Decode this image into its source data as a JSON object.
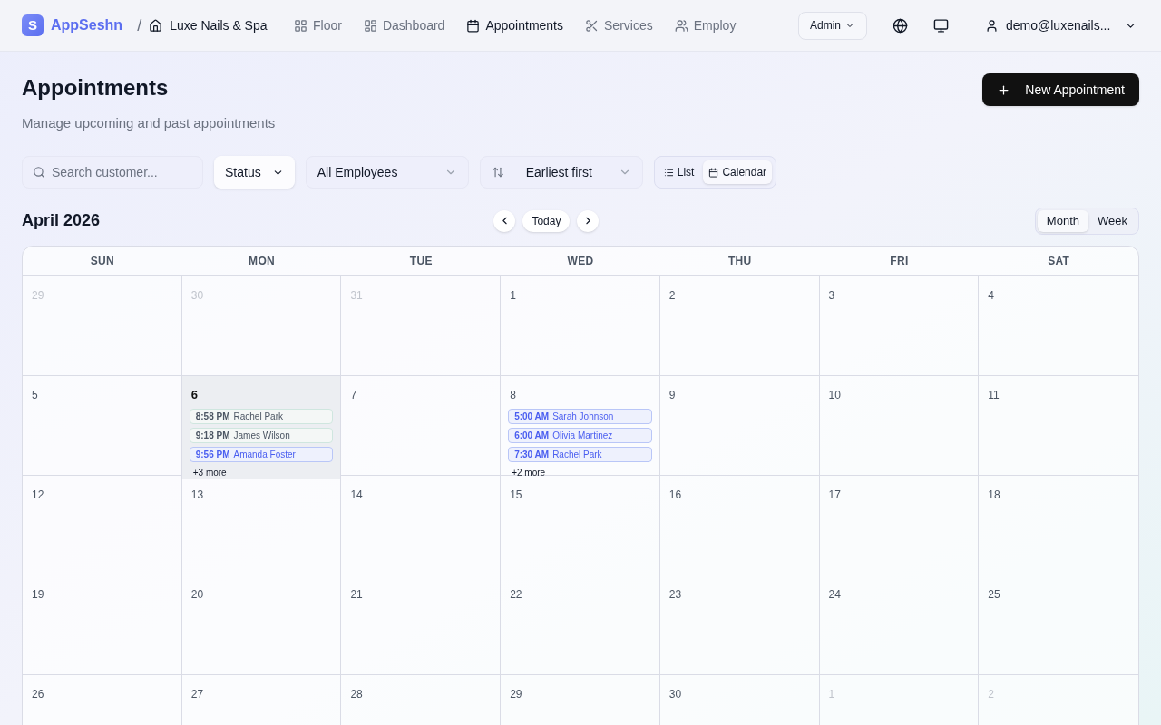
{
  "brand": {
    "logo_letter": "S",
    "name": "AppSeshn",
    "separator": "/",
    "business": "Luxe Nails & Spa"
  },
  "nav": [
    {
      "label": "Floor",
      "selected": false
    },
    {
      "label": "Dashboard",
      "selected": false
    },
    {
      "label": "Appointments",
      "selected": true
    },
    {
      "label": "Services",
      "selected": false
    },
    {
      "label": "Employ",
      "selected": false
    }
  ],
  "role_menu": "Admin",
  "user_menu": "demo@luxenails...",
  "page": {
    "title": "Appointments",
    "subtitle": "Manage upcoming and past appointments",
    "new_button": "New Appointment"
  },
  "filters": {
    "search_placeholder": "Search customer...",
    "status": "Status",
    "employees": "All Employees",
    "sort": "Earliest first",
    "views": [
      {
        "label": "List",
        "selected": false
      },
      {
        "label": "Calendar",
        "selected": true
      }
    ]
  },
  "calendar": {
    "month_label": "April 2026",
    "today_button": "Today",
    "ranges": [
      {
        "label": "Month",
        "selected": true
      },
      {
        "label": "Week",
        "selected": false
      }
    ],
    "weekdays": [
      "SUN",
      "MON",
      "TUE",
      "WED",
      "THU",
      "FRI",
      "SAT"
    ],
    "weeks": [
      [
        {
          "day": "29",
          "in_month": false,
          "selected": false
        },
        {
          "day": "30",
          "in_month": false,
          "selected": false
        },
        {
          "day": "31",
          "in_month": false,
          "selected": false
        },
        {
          "day": "1",
          "in_month": true,
          "selected": false
        },
        {
          "day": "2",
          "in_month": true,
          "selected": false
        },
        {
          "day": "3",
          "in_month": true,
          "selected": false
        },
        {
          "day": "4",
          "in_month": true,
          "selected": false
        }
      ],
      [
        {
          "day": "5",
          "in_month": true,
          "selected": false
        },
        {
          "day": "6",
          "in_month": true,
          "selected": true,
          "events": [
            {
              "time": "8:58 PM",
              "name": "Rachel Park",
              "kind": "completed"
            },
            {
              "time": "9:18 PM",
              "name": "James Wilson",
              "kind": "completed"
            },
            {
              "time": "9:56 PM",
              "name": "Amanda Foster",
              "kind": "scheduled"
            }
          ],
          "more": "+3 more"
        },
        {
          "day": "7",
          "in_month": true,
          "selected": false
        },
        {
          "day": "8",
          "in_month": true,
          "selected": false,
          "events": [
            {
              "time": "5:00 AM",
              "name": "Sarah Johnson",
              "kind": "scheduled"
            },
            {
              "time": "6:00 AM",
              "name": "Olivia Martinez",
              "kind": "scheduled"
            },
            {
              "time": "7:30 AM",
              "name": "Rachel Park",
              "kind": "scheduled"
            }
          ],
          "more": "+2 more"
        },
        {
          "day": "9",
          "in_month": true,
          "selected": false
        },
        {
          "day": "10",
          "in_month": true,
          "selected": false
        },
        {
          "day": "11",
          "in_month": true,
          "selected": false
        }
      ],
      [
        {
          "day": "12",
          "in_month": true,
          "selected": false
        },
        {
          "day": "13",
          "in_month": true,
          "selected": false
        },
        {
          "day": "14",
          "in_month": true,
          "selected": false
        },
        {
          "day": "15",
          "in_month": true,
          "selected": false
        },
        {
          "day": "16",
          "in_month": true,
          "selected": false
        },
        {
          "day": "17",
          "in_month": true,
          "selected": false
        },
        {
          "day": "18",
          "in_month": true,
          "selected": false
        }
      ],
      [
        {
          "day": "19",
          "in_month": true,
          "selected": false
        },
        {
          "day": "20",
          "in_month": true,
          "selected": false
        },
        {
          "day": "21",
          "in_month": true,
          "selected": false
        },
        {
          "day": "22",
          "in_month": true,
          "selected": false
        },
        {
          "day": "23",
          "in_month": true,
          "selected": false
        },
        {
          "day": "24",
          "in_month": true,
          "selected": false
        },
        {
          "day": "25",
          "in_month": true,
          "selected": false
        }
      ],
      [
        {
          "day": "26",
          "in_month": true,
          "selected": false
        },
        {
          "day": "27",
          "in_month": true,
          "selected": false
        },
        {
          "day": "28",
          "in_month": true,
          "selected": false
        },
        {
          "day": "29",
          "in_month": true,
          "selected": false
        },
        {
          "day": "30",
          "in_month": true,
          "selected": false
        },
        {
          "day": "1",
          "in_month": false,
          "selected": false
        },
        {
          "day": "2",
          "in_month": false,
          "selected": false
        }
      ]
    ]
  }
}
